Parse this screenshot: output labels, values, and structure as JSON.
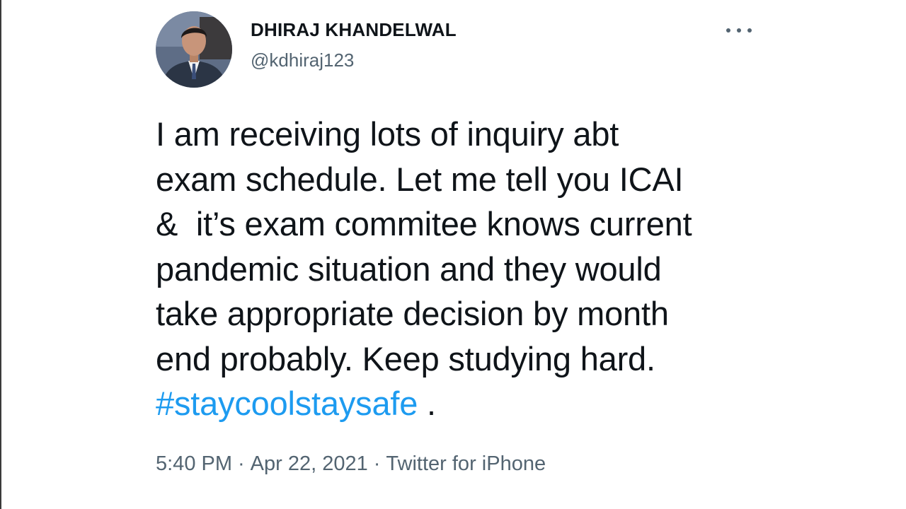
{
  "author": {
    "display_name": "DHIRAJ KHANDELWAL",
    "handle": "@kdhiraj123",
    "avatar_icon": "profile-photo"
  },
  "menu": {
    "icon": "more-options-icon"
  },
  "tweet": {
    "lines": [
      "I am receiving lots of inquiry abt",
      "exam schedule. Let me tell you ICAI",
      "&  it’s exam commitee knows current",
      "pandemic situation and they would",
      "take appropriate decision by month",
      "end probably. Keep studying hard."
    ],
    "hashtag": "#staycoolstaysafe",
    "trailing": " ."
  },
  "meta": {
    "time": "5:40 PM",
    "date": "Apr 22, 2021",
    "separator": "·",
    "source": "Twitter for iPhone"
  },
  "colors": {
    "text": "#0f1419",
    "secondary": "#536471",
    "link": "#1d9bf0"
  }
}
